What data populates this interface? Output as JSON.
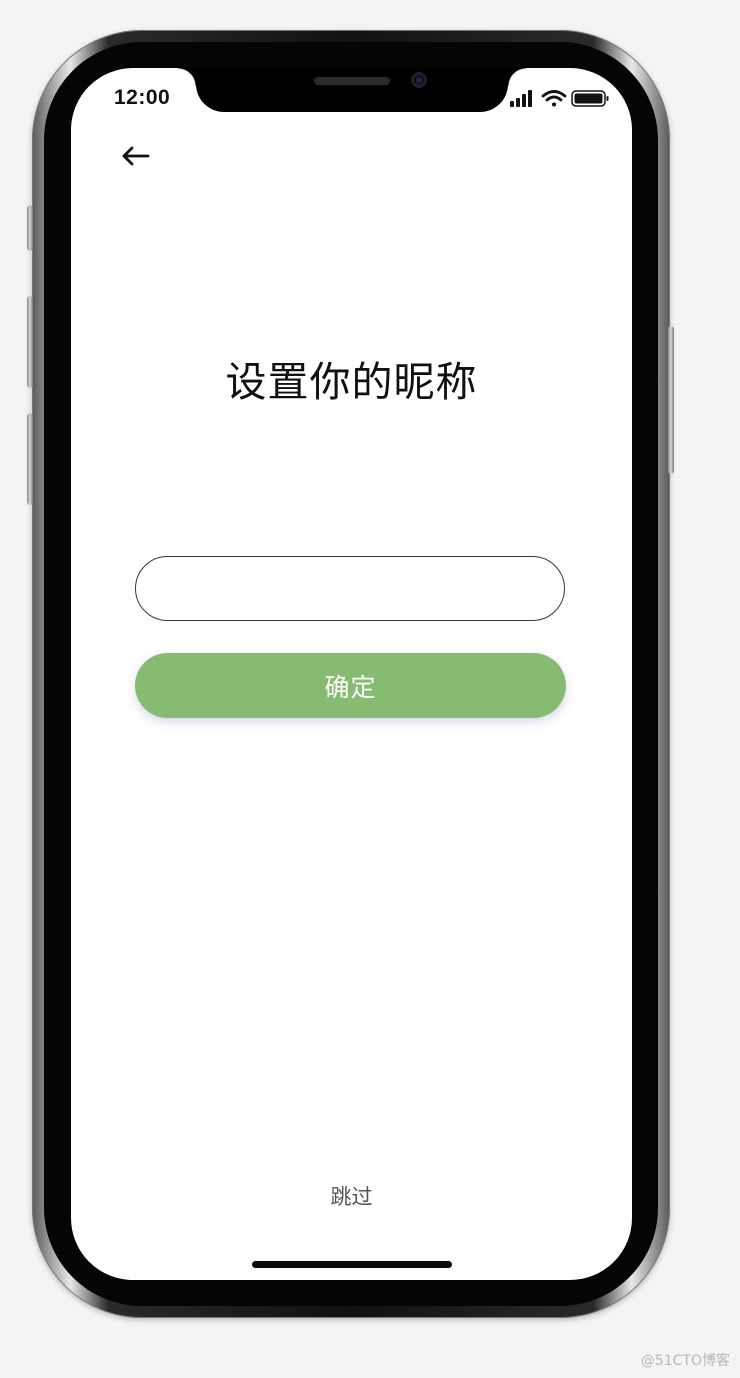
{
  "status_bar": {
    "time": "12:00",
    "signal_icon": "cellular-signal-icon",
    "wifi_icon": "wifi-icon",
    "battery_icon": "battery-icon"
  },
  "nav": {
    "back_icon": "back-arrow-icon"
  },
  "page": {
    "title": "设置你的昵称",
    "nickname_input": {
      "value": "",
      "placeholder": ""
    },
    "confirm_label": "确定",
    "skip_label": "跳过"
  },
  "colors": {
    "primary_button": "#86bc72",
    "input_border": "#283a4c",
    "background": "#ffffff"
  },
  "watermark": "@51CTO博客"
}
